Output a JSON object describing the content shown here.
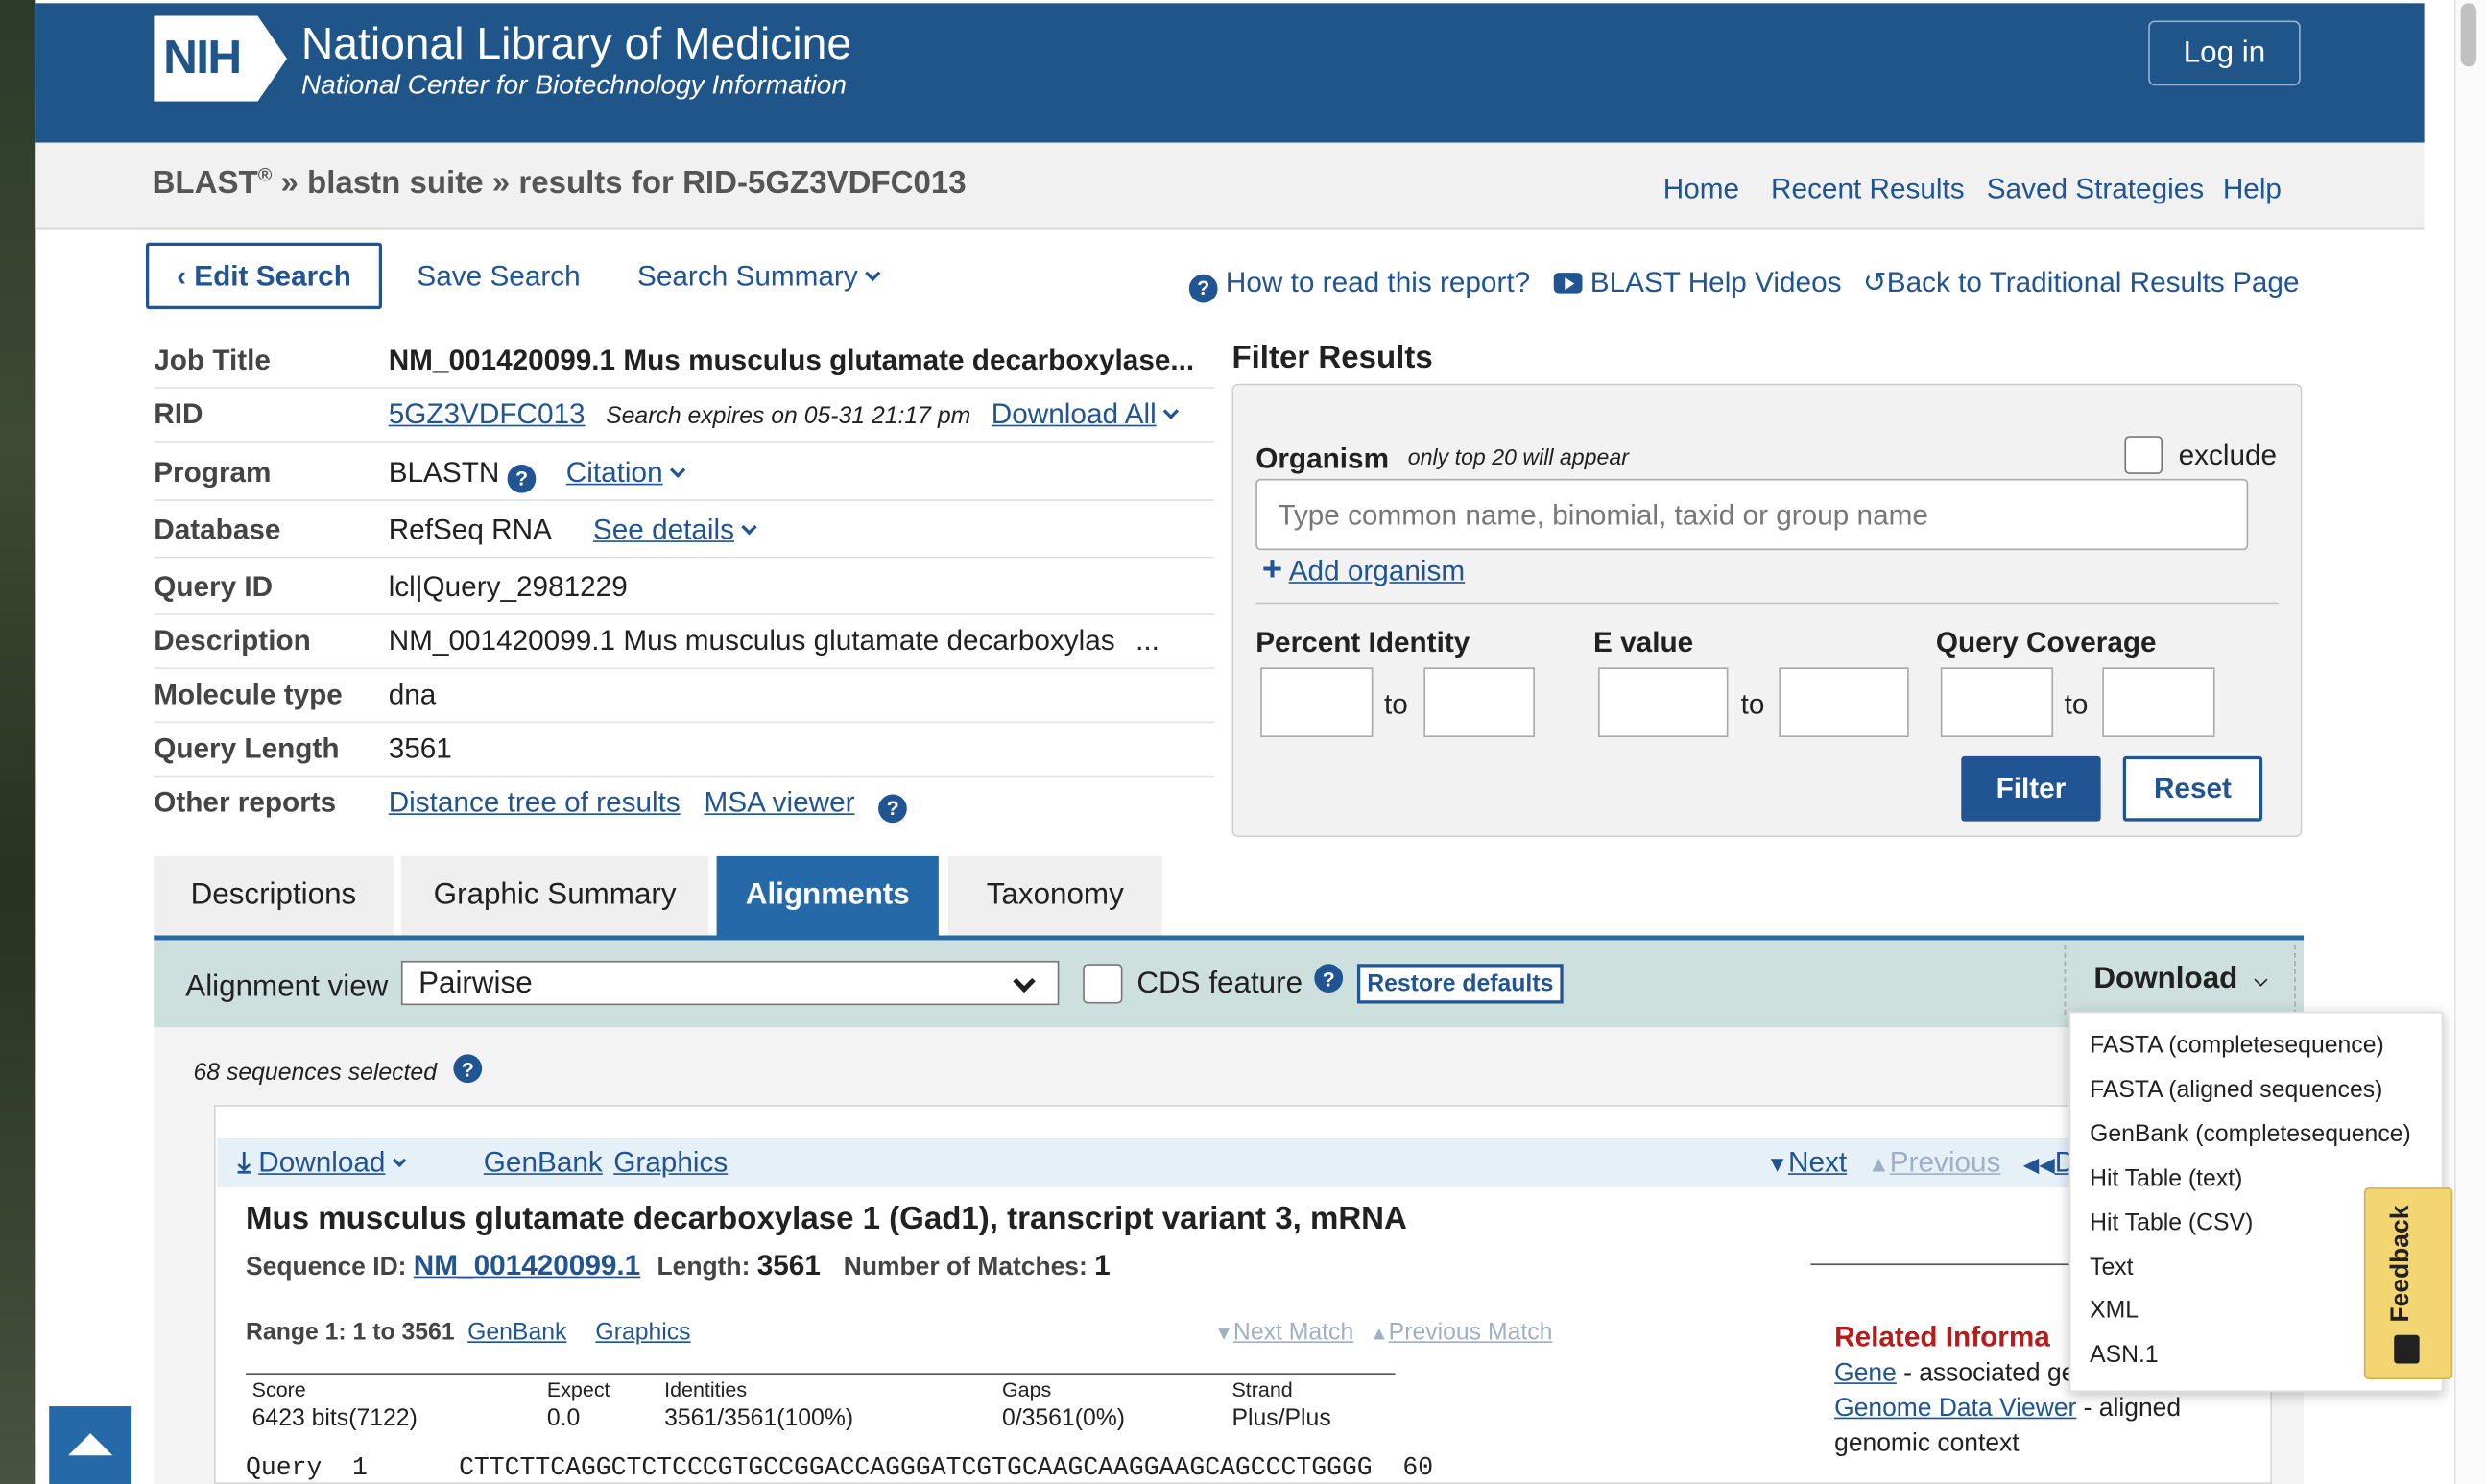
{
  "header": {
    "logo_text": "NIH",
    "title": "National Library of Medicine",
    "subtitle": "National Center for Biotechnology Information",
    "login_label": "Log in"
  },
  "breadcrumb": {
    "blast": "BLAST",
    "reg": "®",
    "rest": " » blastn suite » results for RID-5GZ3VDFC013"
  },
  "topnav": [
    "Home",
    "Recent Results",
    "Saved Strategies",
    "Help"
  ],
  "actions": {
    "edit_search": "Edit Search",
    "save_search": "Save Search",
    "search_summary": "Search Summary",
    "how_to_read": "How to read this report?",
    "help_videos": "BLAST Help Videos",
    "back_traditional": "Back to Traditional Results Page"
  },
  "job": {
    "title_label": "Job Title",
    "title_value": "NM_001420099.1 Mus musculus glutamate decarboxylase...",
    "rid_label": "RID",
    "rid_value": "5GZ3VDFC013",
    "rid_expire": "Search expires on 05-31 21:17 pm",
    "download_all": "Download All",
    "program_label": "Program",
    "program_value": "BLASTN",
    "citation": "Citation",
    "database_label": "Database",
    "database_value": "RefSeq RNA",
    "see_details": "See details",
    "query_id_label": "Query ID",
    "query_id_value": "lcl|Query_2981229",
    "description_label": "Description",
    "description_value": "NM_001420099.1 Mus musculus glutamate decarboxylas",
    "description_more": "...",
    "molecule_label": "Molecule type",
    "molecule_value": "dna",
    "length_label": "Query Length",
    "length_value": "3561",
    "other_label": "Other reports",
    "distance_tree": "Distance tree of results",
    "msa_viewer": "MSA viewer"
  },
  "filter": {
    "title": "Filter Results",
    "organism_label": "Organism",
    "organism_note": "only top 20 will appear",
    "exclude_label": "exclude",
    "organism_placeholder": "Type common  name, binomial, taxid or group  name",
    "add_organism": "Add organism",
    "percent_identity": "Percent Identity",
    "e_value": "E value",
    "query_coverage": "Query Coverage",
    "to": "to",
    "filter_btn": "Filter",
    "reset_btn": "Reset"
  },
  "tabs": [
    "Descriptions",
    "Graphic Summary",
    "Alignments",
    "Taxonomy"
  ],
  "alignment_toolbar": {
    "view_label": "Alignment view",
    "view_value": "Pairwise",
    "cds_label": "CDS feature",
    "restore": "Restore defaults",
    "download": "Download"
  },
  "selection": {
    "count_text": "68 sequences selected"
  },
  "result": {
    "download": "Download",
    "genbank": "GenBank",
    "graphics": "Graphics",
    "next": "Next",
    "previous": "Previous",
    "d_cut": "D",
    "title": "Mus musculus glutamate decarboxylase 1 (Gad1), transcript variant 3, mRNA",
    "seqid_label": "Sequence ID:",
    "seqid_value": "NM_001420099.1",
    "length_label": "Length:",
    "length_value": "3561",
    "matches_label": "Number of Matches:",
    "matches_value": "1",
    "range_label": "Range 1: 1 to 3561",
    "range_genbank": "GenBank",
    "range_graphics": "Graphics",
    "next_match": "Next Match",
    "previous_match": "Previous Match",
    "score_headers": [
      "Score",
      "Expect",
      "Identities",
      "Gaps",
      "Strand"
    ],
    "score_values": [
      "6423 bits(7122)",
      "0.0",
      "3561/3561(100%)",
      "0/3561(0%)",
      "Plus/Plus"
    ],
    "query_line": "Query  1      CTTCTTCAGGCTCTCCCGTGCCGGACCAGGGATCGTGCAAGCAAGGAAGCAGCCCTGGGG  60"
  },
  "related": {
    "title": "Related Informa",
    "gene": "Gene",
    "gene_desc": " - associated ge",
    "gdv": "Genome Data Viewer",
    "gdv_desc": " - aligned",
    "gdv_desc2": "genomic context"
  },
  "download_menu": [
    "FASTA (completesequence)",
    "FASTA (aligned sequences)",
    "GenBank (completesequence)",
    "Hit Table (text)",
    "Hit Table (CSV)",
    "Text",
    "XML",
    "ASN.1"
  ],
  "feedback_label": "Feedback",
  "colors": {
    "header_blue": "#20558a",
    "link_blue": "#205493",
    "tab_active": "#2569a8",
    "toolbar_teal": "#cde0de",
    "feedback_yellow": "#f3d572"
  }
}
